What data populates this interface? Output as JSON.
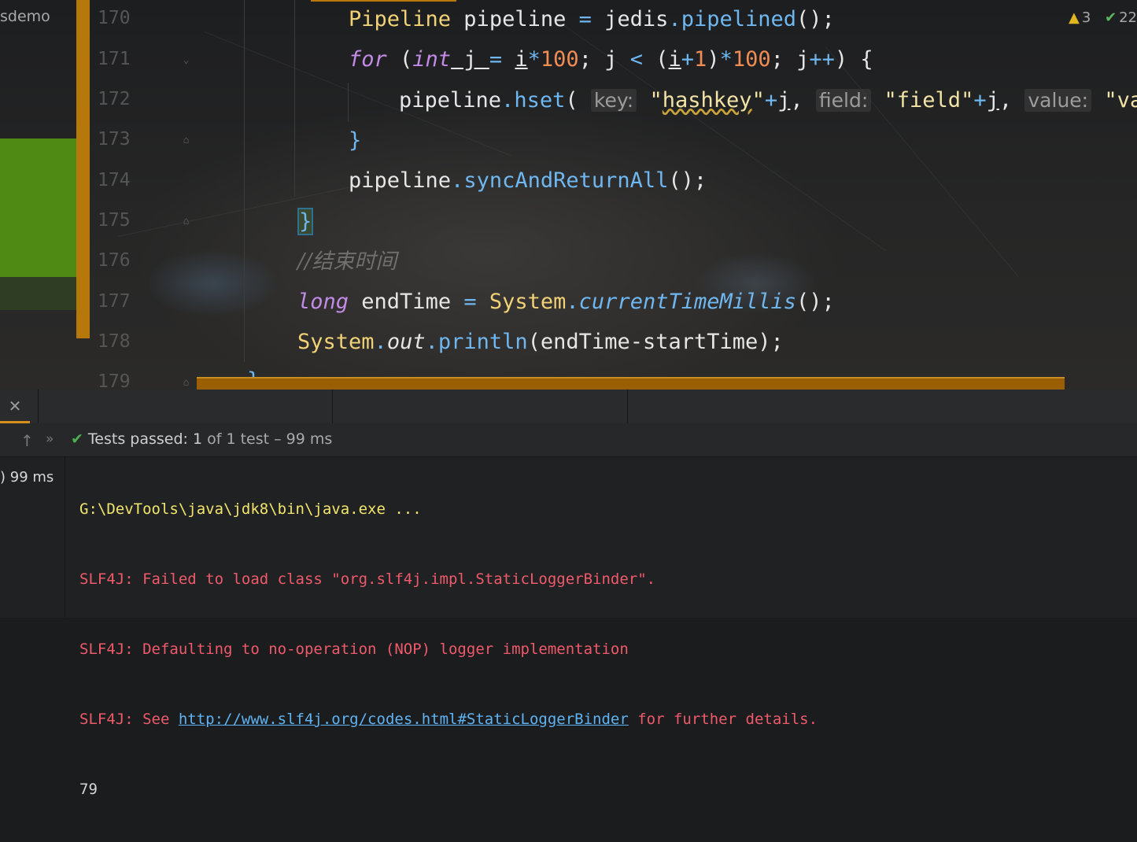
{
  "project": {
    "title": "sdemo"
  },
  "inspection": {
    "warnings": "3",
    "ok_count": "22",
    "warn_icon": "warning-triangle-icon",
    "ok_icon": "double-check-icon"
  },
  "editor": {
    "line_numbers": [
      "170",
      "171",
      "172",
      "173",
      "174",
      "175",
      "176",
      "177",
      "178",
      "179"
    ],
    "line170": {
      "type": "Pipeline",
      "var": " pipeline ",
      "eq": "=",
      "obj": " jedis",
      "dot": ".",
      "method": "pipelined",
      "tail": "();"
    },
    "line171": {
      "for": "for",
      "p1": " (",
      "int": "int",
      "j1": " j ",
      "eq": "=",
      "i1": "i",
      "star1": "*",
      "n100a": "100",
      "semi1": "; j ",
      "lt": "<",
      "p2": " (",
      "i2": "i",
      "plus": "+",
      "one": "1",
      "p3": ")",
      "star2": "*",
      "n100b": "100",
      "semi2": "; j",
      "pp": "++",
      "end": ") {"
    },
    "line172": {
      "obj": "pipeline",
      "dot": ".",
      "method": "hset",
      "open": "( ",
      "hint_key": "key:",
      "q1": "\"",
      "s_hashkey": "hashkey",
      "q1e": "\"",
      "plus1": "+",
      "j1": "j",
      "c1": ",",
      "hint_field": "field:",
      "s_field": "\"field\"",
      "plus2": "+",
      "j2": "j",
      "c2": ",",
      "hint_value": "value:",
      "s_value": "\"value\"",
      "tail": "+"
    },
    "line173": {
      "brace": "}"
    },
    "line174": {
      "obj": "pipeline",
      "dot": ".",
      "method": "syncAndReturnAll",
      "tail": "();"
    },
    "line175": {
      "brace": "}"
    },
    "line176": {
      "comment": "//结束时间"
    },
    "line177": {
      "kw": "long",
      "var": " endTime ",
      "eq": "=",
      "cls": " System",
      "dot": ".",
      "method": "currentTimeMillis",
      "tail": "();"
    },
    "line178": {
      "cls": "System",
      "dot1": ".",
      "field": "out",
      "dot2": ".",
      "method": "println",
      "tail": "(endTime-startTime);"
    },
    "line179": {
      "brace": "}"
    }
  },
  "run": {
    "close_icon": "close-icon",
    "tests": {
      "check_icon": "check-icon",
      "label": "Tests passed:",
      "count": "1",
      "of_text": "of 1 test – 99 ms"
    },
    "tree": {
      "item_time": ") 99 ms"
    },
    "console": {
      "cmd": "G:\\DevTools\\java\\jdk8\\bin\\java.exe ...",
      "err1": "SLF4J: Failed to load class \"org.slf4j.impl.StaticLoggerBinder\".",
      "err2": "SLF4J: Defaulting to no-operation (NOP) logger implementation",
      "err3_prefix": "SLF4J: See ",
      "err3_link": "http://www.slf4j.org/codes.html#StaticLoggerBinder",
      "err3_suffix": " for further details.",
      "out": "79"
    }
  },
  "colors": {
    "accent": "#b6780a",
    "green_panel": "#4f8a15",
    "error": "#ef5a6b",
    "link": "#5fb3f2"
  }
}
